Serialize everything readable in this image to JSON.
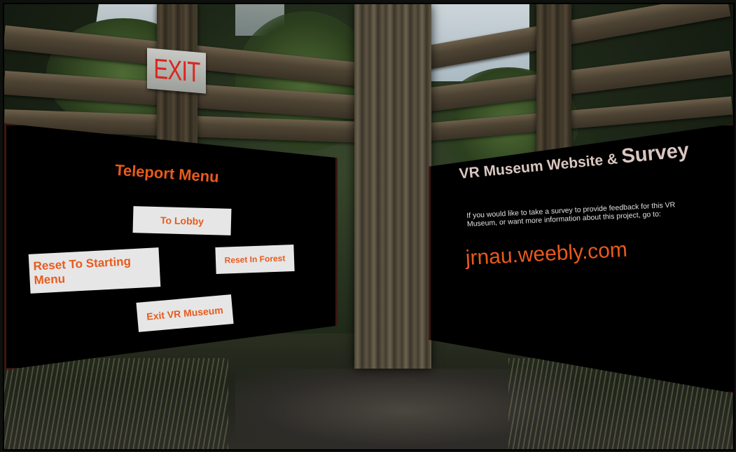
{
  "exit_sign": {
    "text": "EXIT"
  },
  "teleport_menu": {
    "title": "Teleport Menu",
    "buttons": {
      "to_lobby": "To Lobby",
      "reset_starting_menu": "Reset To Starting Menu",
      "reset_in_forest": "Reset In Forest",
      "exit_vr_museum": "Exit VR Museum"
    }
  },
  "info_panel": {
    "title_a": "VR Museum Website & ",
    "title_b": "Survey",
    "body": "If you would like to take a survey to provide feedback for this VR Museum, or want more information about this project, go to:",
    "link": "jrnau.weebly.com"
  },
  "colors": {
    "accent": "#e85a1c",
    "button_bg": "#e6e6e6",
    "panel_bg": "#000000",
    "exit_red": "#d8261f"
  }
}
